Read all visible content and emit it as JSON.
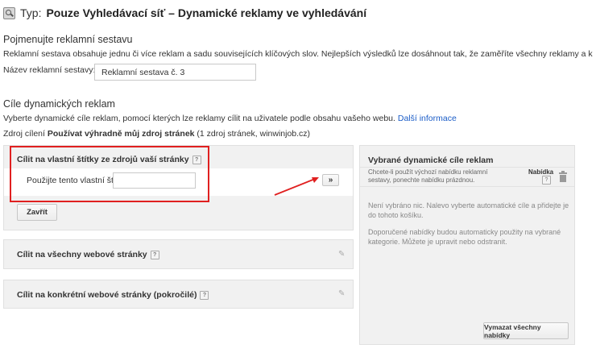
{
  "header": {
    "type_label": "Typ:",
    "type_value": "Pouze Vyhledávací síť – Dynamické reklamy ve vyhledávání"
  },
  "ad_group_name": {
    "title": "Pojmenujte reklamní sestavu",
    "description": "Reklamní sestava obsahuje jednu či více reklam a sadu souvisejících klíčových slov. Nejlepších výsledků lze dosáhnout tak, že zaměříte všechny reklamy a klíčová slova v této reklamní sestav",
    "field_label": "Název reklamní sestavy:",
    "field_value": "Reklamní sestava č. 3"
  },
  "dynamic_targets": {
    "title": "Cíle dynamických reklam",
    "description": "Vyberte dynamické cíle reklam, pomocí kterých lze reklamy cílit na uživatele podle obsahu vašeho webu.",
    "more_info_link": "Další informace",
    "source_prefix": "Zdroj cílení",
    "source_bold": "Používat výhradně můj zdroj stránek",
    "source_suffix": "(1 zdroj stránek, winwinjob.cz)"
  },
  "custom_labels_panel": {
    "title": "Cílit na vlastní štítky ze zdrojů vaší stránky",
    "help": "?",
    "field_label": "Použijte tento vlastní štítek:",
    "field_value": "",
    "add_button": "»",
    "close_button": "Zavřít"
  },
  "all_pages_panel": {
    "title": "Cílit na všechny webové stránky",
    "help": "?"
  },
  "specific_pages_panel": {
    "title": "Cílit na konkrétní webové stránky (pokročilé)",
    "help": "?"
  },
  "selected_panel": {
    "title": "Vybrané dynamické cíle reklam",
    "default_bid_text": "Chcete-li použít výchozí nabídku reklamní sestavy, ponechte nabídku prázdnou.",
    "bid_header": "Nabídka",
    "help": "?",
    "empty_text": "Není vybráno nic. Nalevo vyberte automatické cíle a přidejte je do tohoto košíku.",
    "recommend_text": "Doporučené nabídky budou automaticky použity na vybrané kategorie. Můžete je upravit nebo odstranit.",
    "clear_button": "Vymazat všechny nabídky"
  },
  "colors": {
    "highlight": "#e02020",
    "link": "#1a5cc7",
    "panel_bg": "#f1f1f1"
  }
}
